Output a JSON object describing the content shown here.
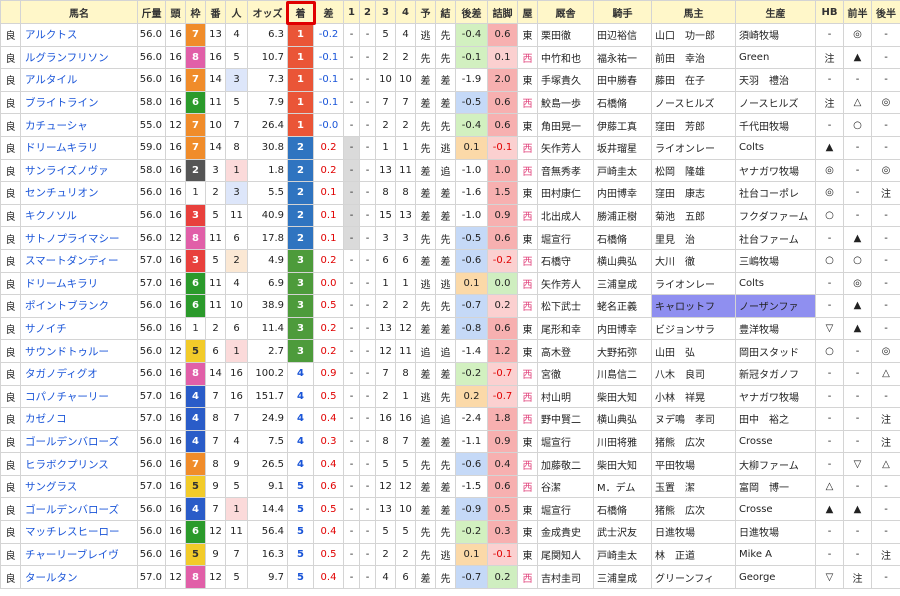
{
  "headers": [
    "",
    "馬名",
    "斤量",
    "頭",
    "枠",
    "番",
    "人",
    "オッズ",
    "着",
    "差",
    "1",
    "2",
    "3",
    "4",
    "予",
    "結",
    "後差",
    "詰脚",
    "屋",
    "厩舎",
    "騎手",
    "馬主",
    "生産",
    "HB",
    "前半",
    "後半"
  ],
  "colors": {
    "waku": {
      "1": "#ffffff",
      "2": "#555555",
      "3": "#e8403c",
      "4": "#2a5cc8",
      "5": "#f2cb2a",
      "6": "#2b9a2b",
      "7": "#f08c2a",
      "8": "#e15fa8"
    },
    "chaku": {
      "1": "#ea5537",
      "2": "#2f74c0",
      "3": "#4d9b3b",
      "4": "#ffffff",
      "5": "#ffffff"
    },
    "ninki_top": "#fbdada",
    "ninki_second": "#dde6fa",
    "ninki_third": "#fbe8d4",
    "kosa_good": "#d2f0c0",
    "kosa_orange": "#fbd9a8",
    "kosa_blue": "#c5d9f7",
    "tsume_red": "#f7b0b0",
    "tsume_pink": "#fbd0d0",
    "tsume_green": "#cfeec0",
    "west": "#e0407a",
    "owner_hl": "#8f8ff0",
    "highlight": "#e00000"
  },
  "rows": [
    {
      "baba": "良",
      "name": "アルクトス",
      "kin": "56.0",
      "to": "16",
      "waku": "7",
      "ban": "13",
      "nin": "4",
      "odds": "6.3",
      "chaku": "1",
      "sa": "-0.2",
      "c1": "-",
      "c2": "-",
      "c3": "5",
      "c4": "4",
      "yo": "逃",
      "ke": "先",
      "kosa": "-0.4",
      "kosa_c": "good",
      "tsume": "0.6",
      "tsume_c": "red",
      "ya": "東",
      "kyu": "栗田徹",
      "kishu": "田辺裕信",
      "owner": "山口　功一郎",
      "sei": "須崎牧場",
      "hb": "-",
      "zen": "◎",
      "kou": "-"
    },
    {
      "baba": "良",
      "name": "ルグランフリソン",
      "kin": "56.0",
      "to": "16",
      "waku": "8",
      "ban": "16",
      "nin": "5",
      "odds": "10.7",
      "chaku": "1",
      "sa": "-0.1",
      "c1": "-",
      "c2": "-",
      "c3": "2",
      "c4": "2",
      "yo": "先",
      "ke": "先",
      "kosa": "-0.1",
      "kosa_c": "good",
      "tsume": "0.1",
      "tsume_c": "pink",
      "ya": "西",
      "kyu": "中竹和也",
      "kishu": "福永祐一",
      "owner": "前田　幸治",
      "sei": "Green",
      "hb": "注",
      "zen": "▲",
      "kou": "-"
    },
    {
      "baba": "良",
      "name": "アルタイル",
      "kin": "56.0",
      "to": "16",
      "waku": "7",
      "ban": "14",
      "nin": "3",
      "odds": "7.3",
      "chaku": "1",
      "sa": "-0.1",
      "c1": "-",
      "c2": "-",
      "c3": "10",
      "c4": "10",
      "yo": "差",
      "ke": "差",
      "kosa": "-1.9",
      "kosa_c": "",
      "tsume": "2.0",
      "tsume_c": "red",
      "ya": "東",
      "kyu": "手塚貴久",
      "kishu": "田中勝春",
      "owner": "藤田　在子",
      "sei": "天羽　禮治",
      "hb": "-",
      "zen": "-",
      "kou": "-"
    },
    {
      "baba": "良",
      "name": "ブライトライン",
      "kin": "58.0",
      "to": "16",
      "waku": "6",
      "ban": "11",
      "nin": "5",
      "odds": "7.9",
      "chaku": "1",
      "sa": "-0.1",
      "c1": "-",
      "c2": "-",
      "c3": "7",
      "c4": "7",
      "yo": "差",
      "ke": "差",
      "kosa": "-0.5",
      "kosa_c": "blue",
      "tsume": "0.6",
      "tsume_c": "red",
      "ya": "西",
      "kyu": "鮫島一歩",
      "kishu": "石橋脩",
      "owner": "ノースヒルズ",
      "sei": "ノースヒルズ",
      "hb": "注",
      "zen": "△",
      "kou": "◎"
    },
    {
      "baba": "良",
      "name": "カチューシャ",
      "kin": "55.0",
      "to": "12",
      "waku": "7",
      "ban": "10",
      "nin": "7",
      "odds": "26.4",
      "chaku": "1",
      "sa": "-0.0",
      "c1": "-",
      "c2": "-",
      "c3": "2",
      "c4": "2",
      "yo": "先",
      "ke": "先",
      "kosa": "-0.4",
      "kosa_c": "good",
      "tsume": "0.6",
      "tsume_c": "red",
      "ya": "東",
      "kyu": "角田晃一",
      "kishu": "伊藤工真",
      "owner": "窪田　芳郎",
      "sei": "千代田牧場",
      "hb": "-",
      "zen": "○",
      "kou": "-"
    },
    {
      "baba": "良",
      "name": "ドリームキラリ",
      "kin": "59.0",
      "to": "16",
      "waku": "7",
      "ban": "14",
      "nin": "8",
      "odds": "30.8",
      "chaku": "2",
      "sa": "0.2",
      "c1": "-",
      "c2": "-",
      "c3": "1",
      "c4": "1",
      "yo": "先",
      "ke": "逃",
      "kosa": "0.1",
      "kosa_c": "orange",
      "tsume": "-0.1",
      "tsume_c": "pink",
      "ya": "西",
      "kyu": "矢作芳人",
      "kishu": "坂井瑠星",
      "owner": "ライオンレー",
      "sei": "Colts",
      "hb": "▲",
      "zen": "-",
      "kou": "-"
    },
    {
      "baba": "良",
      "name": "サンライズノヴァ",
      "kin": "58.0",
      "to": "16",
      "waku": "2",
      "ban": "3",
      "nin": "1",
      "odds": "1.8",
      "chaku": "2",
      "sa": "0.2",
      "c1": "-",
      "c2": "-",
      "c3": "13",
      "c4": "11",
      "yo": "差",
      "ke": "追",
      "kosa": "-1.0",
      "kosa_c": "",
      "tsume": "1.0",
      "tsume_c": "red",
      "ya": "西",
      "kyu": "音無秀孝",
      "kishu": "戸崎圭太",
      "owner": "松岡　隆雄",
      "sei": "ヤナガワ牧場",
      "hb": "◎",
      "zen": "-",
      "kou": "◎"
    },
    {
      "baba": "良",
      "name": "センチュリオン",
      "kin": "56.0",
      "to": "16",
      "waku": "1",
      "ban": "2",
      "nin": "3",
      "odds": "5.5",
      "chaku": "2",
      "sa": "0.1",
      "c1": "-",
      "c2": "-",
      "c3": "8",
      "c4": "8",
      "yo": "差",
      "ke": "差",
      "kosa": "-1.6",
      "kosa_c": "",
      "tsume": "1.5",
      "tsume_c": "red",
      "ya": "東",
      "kyu": "田村康仁",
      "kishu": "内田博幸",
      "owner": "窪田　康志",
      "sei": "社台コーポレ",
      "hb": "◎",
      "zen": "-",
      "kou": "注"
    },
    {
      "baba": "良",
      "name": "キクノソル",
      "kin": "56.0",
      "to": "16",
      "waku": "3",
      "ban": "5",
      "nin": "11",
      "odds": "40.9",
      "chaku": "2",
      "sa": "0.1",
      "c1": "-",
      "c2": "-",
      "c3": "15",
      "c4": "13",
      "yo": "差",
      "ke": "差",
      "kosa": "-1.0",
      "kosa_c": "",
      "tsume": "0.9",
      "tsume_c": "red",
      "ya": "西",
      "kyu": "北出成人",
      "kishu": "勝浦正樹",
      "owner": "菊池　五郎",
      "sei": "フクダファーム",
      "hb": "○",
      "zen": "-",
      "kou": "-"
    },
    {
      "baba": "良",
      "name": "サトノプライマシー",
      "kin": "56.0",
      "to": "12",
      "waku": "8",
      "ban": "11",
      "nin": "6",
      "odds": "17.8",
      "chaku": "2",
      "sa": "0.1",
      "c1": "-",
      "c2": "-",
      "c3": "3",
      "c4": "3",
      "yo": "先",
      "ke": "先",
      "kosa": "-0.5",
      "kosa_c": "blue",
      "tsume": "0.6",
      "tsume_c": "red",
      "ya": "東",
      "kyu": "堀宣行",
      "kishu": "石橋脩",
      "owner": "里見　治",
      "sei": "社台ファーム",
      "hb": "-",
      "zen": "▲",
      "kou": "-"
    },
    {
      "baba": "良",
      "name": "スマートダンディー",
      "kin": "57.0",
      "to": "16",
      "waku": "3",
      "ban": "5",
      "nin": "2",
      "odds": "4.9",
      "chaku": "3",
      "sa": "0.2",
      "c1": "-",
      "c2": "-",
      "c3": "6",
      "c4": "6",
      "yo": "差",
      "ke": "差",
      "kosa": "-0.6",
      "kosa_c": "blue",
      "tsume": "-0.2",
      "tsume_c": "pink",
      "ya": "西",
      "kyu": "石橋守",
      "kishu": "横山典弘",
      "owner": "大川　徹",
      "sei": "三嶋牧場",
      "hb": "○",
      "zen": "○",
      "kou": "-"
    },
    {
      "baba": "良",
      "name": "ドリームキラリ",
      "kin": "57.0",
      "to": "16",
      "waku": "6",
      "ban": "11",
      "nin": "4",
      "odds": "6.9",
      "chaku": "3",
      "sa": "0.0",
      "c1": "-",
      "c2": "-",
      "c3": "1",
      "c4": "1",
      "yo": "逃",
      "ke": "逃",
      "kosa": "0.1",
      "kosa_c": "orange",
      "tsume": "0.0",
      "tsume_c": "green",
      "ya": "西",
      "kyu": "矢作芳人",
      "kishu": "三浦皇成",
      "owner": "ライオンレー",
      "sei": "Colts",
      "hb": "-",
      "zen": "◎",
      "kou": "-"
    },
    {
      "baba": "良",
      "name": "ポイントブランク",
      "kin": "56.0",
      "to": "16",
      "waku": "6",
      "ban": "11",
      "nin": "10",
      "odds": "38.9",
      "chaku": "3",
      "sa": "0.5",
      "c1": "-",
      "c2": "-",
      "c3": "2",
      "c4": "2",
      "yo": "先",
      "ke": "先",
      "kosa": "-0.7",
      "kosa_c": "blue",
      "tsume": "0.2",
      "tsume_c": "pink",
      "ya": "西",
      "kyu": "松下武士",
      "kishu": "蛯名正義",
      "owner": "キャロットフ",
      "sei": "ノーザンファ",
      "hb": "-",
      "zen": "▲",
      "kou": "-"
    },
    {
      "baba": "良",
      "name": "サノイチ",
      "kin": "56.0",
      "to": "16",
      "waku": "1",
      "ban": "2",
      "nin": "6",
      "odds": "11.4",
      "chaku": "3",
      "sa": "0.2",
      "c1": "-",
      "c2": "-",
      "c3": "13",
      "c4": "12",
      "yo": "差",
      "ke": "差",
      "kosa": "-0.8",
      "kosa_c": "blue",
      "tsume": "0.6",
      "tsume_c": "red",
      "ya": "東",
      "kyu": "尾形和幸",
      "kishu": "内田博幸",
      "owner": "ビジョンサラ",
      "sei": "豊洋牧場",
      "hb": "▽",
      "zen": "▲",
      "kou": "-"
    },
    {
      "baba": "良",
      "name": "サウンドトゥルー",
      "kin": "56.0",
      "to": "12",
      "waku": "5",
      "ban": "6",
      "nin": "1",
      "odds": "2.7",
      "chaku": "3",
      "sa": "0.2",
      "c1": "-",
      "c2": "-",
      "c3": "12",
      "c4": "11",
      "yo": "追",
      "ke": "追",
      "kosa": "-1.4",
      "kosa_c": "",
      "tsume": "1.2",
      "tsume_c": "red",
      "ya": "東",
      "kyu": "高木登",
      "kishu": "大野拓弥",
      "owner": "山田　弘",
      "sei": "岡田スタッド",
      "hb": "○",
      "zen": "-",
      "kou": "◎"
    },
    {
      "baba": "良",
      "name": "タガノディグオ",
      "kin": "56.0",
      "to": "16",
      "waku": "8",
      "ban": "14",
      "nin": "16",
      "odds": "100.2",
      "chaku": "4",
      "sa": "0.9",
      "c1": "-",
      "c2": "-",
      "c3": "7",
      "c4": "8",
      "yo": "差",
      "ke": "差",
      "kosa": "-0.2",
      "kosa_c": "good",
      "tsume": "-0.7",
      "tsume_c": "pink",
      "ya": "西",
      "kyu": "宮徹",
      "kishu": "川島信二",
      "owner": "八木　良司",
      "sei": "新冠タガノフ",
      "hb": "-",
      "zen": "-",
      "kou": "△"
    },
    {
      "baba": "良",
      "name": "コパノチャーリー",
      "kin": "57.0",
      "to": "16",
      "waku": "4",
      "ban": "7",
      "nin": "16",
      "odds": "151.7",
      "chaku": "4",
      "sa": "0.5",
      "c1": "-",
      "c2": "-",
      "c3": "2",
      "c4": "1",
      "yo": "逃",
      "ke": "先",
      "kosa": "0.2",
      "kosa_c": "orange",
      "tsume": "-0.7",
      "tsume_c": "pink",
      "ya": "西",
      "kyu": "村山明",
      "kishu": "柴田大知",
      "owner": "小林　祥晃",
      "sei": "ヤナガワ牧場",
      "hb": "-",
      "zen": "-",
      "kou": "-"
    },
    {
      "baba": "良",
      "name": "カゼノコ",
      "kin": "57.0",
      "to": "16",
      "waku": "4",
      "ban": "8",
      "nin": "7",
      "odds": "24.9",
      "chaku": "4",
      "sa": "0.4",
      "c1": "-",
      "c2": "-",
      "c3": "16",
      "c4": "16",
      "yo": "追",
      "ke": "追",
      "kosa": "-2.4",
      "kosa_c": "",
      "tsume": "1.8",
      "tsume_c": "red",
      "ya": "西",
      "kyu": "野中賢二",
      "kishu": "横山典弘",
      "owner": "ヌデ鳴　孝司",
      "sei": "田中　裕之",
      "hb": "-",
      "zen": "-",
      "kou": "注"
    },
    {
      "baba": "良",
      "name": "ゴールデンバローズ",
      "kin": "56.0",
      "to": "16",
      "waku": "4",
      "ban": "7",
      "nin": "4",
      "odds": "7.5",
      "chaku": "4",
      "sa": "0.3",
      "c1": "-",
      "c2": "-",
      "c3": "8",
      "c4": "7",
      "yo": "差",
      "ke": "差",
      "kosa": "-1.1",
      "kosa_c": "",
      "tsume": "0.9",
      "tsume_c": "red",
      "ya": "東",
      "kyu": "堀宣行",
      "kishu": "川田将雅",
      "owner": "猪熊　広次",
      "sei": "Crosse",
      "hb": "-",
      "zen": "-",
      "kou": "注"
    },
    {
      "baba": "良",
      "name": "ヒラボクプリンス",
      "kin": "56.0",
      "to": "16",
      "waku": "7",
      "ban": "8",
      "nin": "9",
      "odds": "26.5",
      "chaku": "4",
      "sa": "0.4",
      "c1": "-",
      "c2": "-",
      "c3": "5",
      "c4": "5",
      "yo": "先",
      "ke": "先",
      "kosa": "-0.6",
      "kosa_c": "blue",
      "tsume": "0.4",
      "tsume_c": "red",
      "ya": "西",
      "kyu": "加藤敬二",
      "kishu": "柴田大知",
      "owner": "平田牧場",
      "sei": "大柳ファーム",
      "hb": "-",
      "zen": "▽",
      "kou": "△"
    },
    {
      "baba": "良",
      "name": "サングラス",
      "kin": "57.0",
      "to": "16",
      "waku": "5",
      "ban": "9",
      "nin": "5",
      "odds": "9.1",
      "chaku": "5",
      "sa": "0.6",
      "c1": "-",
      "c2": "-",
      "c3": "12",
      "c4": "12",
      "yo": "差",
      "ke": "差",
      "kosa": "-1.5",
      "kosa_c": "",
      "tsume": "0.6",
      "tsume_c": "red",
      "ya": "西",
      "kyu": "谷潔",
      "kishu": "M．デム",
      "owner": "玉置　潔",
      "sei": "富岡　博一",
      "hb": "△",
      "zen": "-",
      "kou": "-"
    },
    {
      "baba": "良",
      "name": "ゴールデンバローズ",
      "kin": "56.0",
      "to": "16",
      "waku": "4",
      "ban": "7",
      "nin": "1",
      "odds": "14.4",
      "chaku": "5",
      "sa": "0.5",
      "c1": "-",
      "c2": "-",
      "c3": "13",
      "c4": "10",
      "yo": "差",
      "ke": "差",
      "kosa": "-0.9",
      "kosa_c": "blue",
      "tsume": "0.5",
      "tsume_c": "red",
      "ya": "東",
      "kyu": "堀宣行",
      "kishu": "石橋脩",
      "owner": "猪熊　広次",
      "sei": "Crosse",
      "hb": "▲",
      "zen": "▲",
      "kou": "-"
    },
    {
      "baba": "良",
      "name": "マッチレスヒーロー",
      "kin": "56.0",
      "to": "16",
      "waku": "6",
      "ban": "12",
      "nin": "11",
      "odds": "56.4",
      "chaku": "5",
      "sa": "0.4",
      "c1": "-",
      "c2": "-",
      "c3": "5",
      "c4": "5",
      "yo": "先",
      "ke": "先",
      "kosa": "-0.2",
      "kosa_c": "good",
      "tsume": "0.3",
      "tsume_c": "red",
      "ya": "東",
      "kyu": "金成貴史",
      "kishu": "武士沢友",
      "owner": "日進牧場",
      "sei": "日進牧場",
      "hb": "-",
      "zen": "-",
      "kou": "-"
    },
    {
      "baba": "良",
      "name": "チャーリーブレイヴ",
      "kin": "56.0",
      "to": "16",
      "waku": "5",
      "ban": "9",
      "nin": "7",
      "odds": "16.3",
      "chaku": "5",
      "sa": "0.5",
      "c1": "-",
      "c2": "-",
      "c3": "2",
      "c4": "2",
      "yo": "先",
      "ke": "逃",
      "kosa": "0.1",
      "kosa_c": "orange",
      "tsume": "-0.1",
      "tsume_c": "pink",
      "ya": "東",
      "kyu": "尾関知人",
      "kishu": "戸崎圭太",
      "owner": "林　正道",
      "sei": "Mike A",
      "hb": "-",
      "zen": "-",
      "kou": "注"
    },
    {
      "baba": "良",
      "name": "タールタン",
      "kin": "57.0",
      "to": "12",
      "waku": "8",
      "ban": "12",
      "nin": "5",
      "odds": "9.7",
      "chaku": "5",
      "sa": "0.4",
      "c1": "-",
      "c2": "-",
      "c3": "4",
      "c4": "6",
      "yo": "差",
      "ke": "先",
      "kosa": "-0.7",
      "kosa_c": "blue",
      "tsume": "0.2",
      "tsume_c": "green",
      "ya": "西",
      "kyu": "吉村圭司",
      "kishu": "三浦皇成",
      "owner": "グリーンフィ",
      "sei": "George",
      "hb": "▽",
      "zen": "注",
      "kou": "-"
    }
  ]
}
